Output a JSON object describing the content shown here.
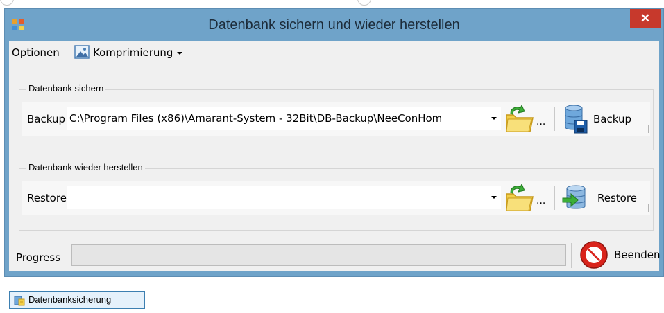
{
  "window": {
    "title": "Datenbank sichern und wieder herstellen",
    "close_glyph": "✕",
    "app_icon": "app-grid-icon"
  },
  "menu": {
    "options_label": "Optionen",
    "compression_label": "Komprimierung",
    "compression_icon": "image-icon"
  },
  "backup_group": {
    "title": "Datenbank sichern",
    "label": "Backup",
    "path_value": "C:\\Program Files (x86)\\Amarant-System - 32Bit\\DB-Backup\\NeeConHom",
    "browse_dots": "...",
    "button_label": "Backup"
  },
  "restore_group": {
    "title": "Datenbank wieder herstellen",
    "label": "Restore",
    "path_value": "",
    "browse_dots": "...",
    "button_label": "Restore"
  },
  "progress": {
    "label": "Progress",
    "value": 0
  },
  "quit_button_label": "Beenden",
  "taskbar": {
    "button_label": "Datenbanksicherung"
  },
  "colors": {
    "title_bar": "#6fa3c9",
    "close_button": "#c7392c",
    "client_bg": "#f0f0f0"
  }
}
